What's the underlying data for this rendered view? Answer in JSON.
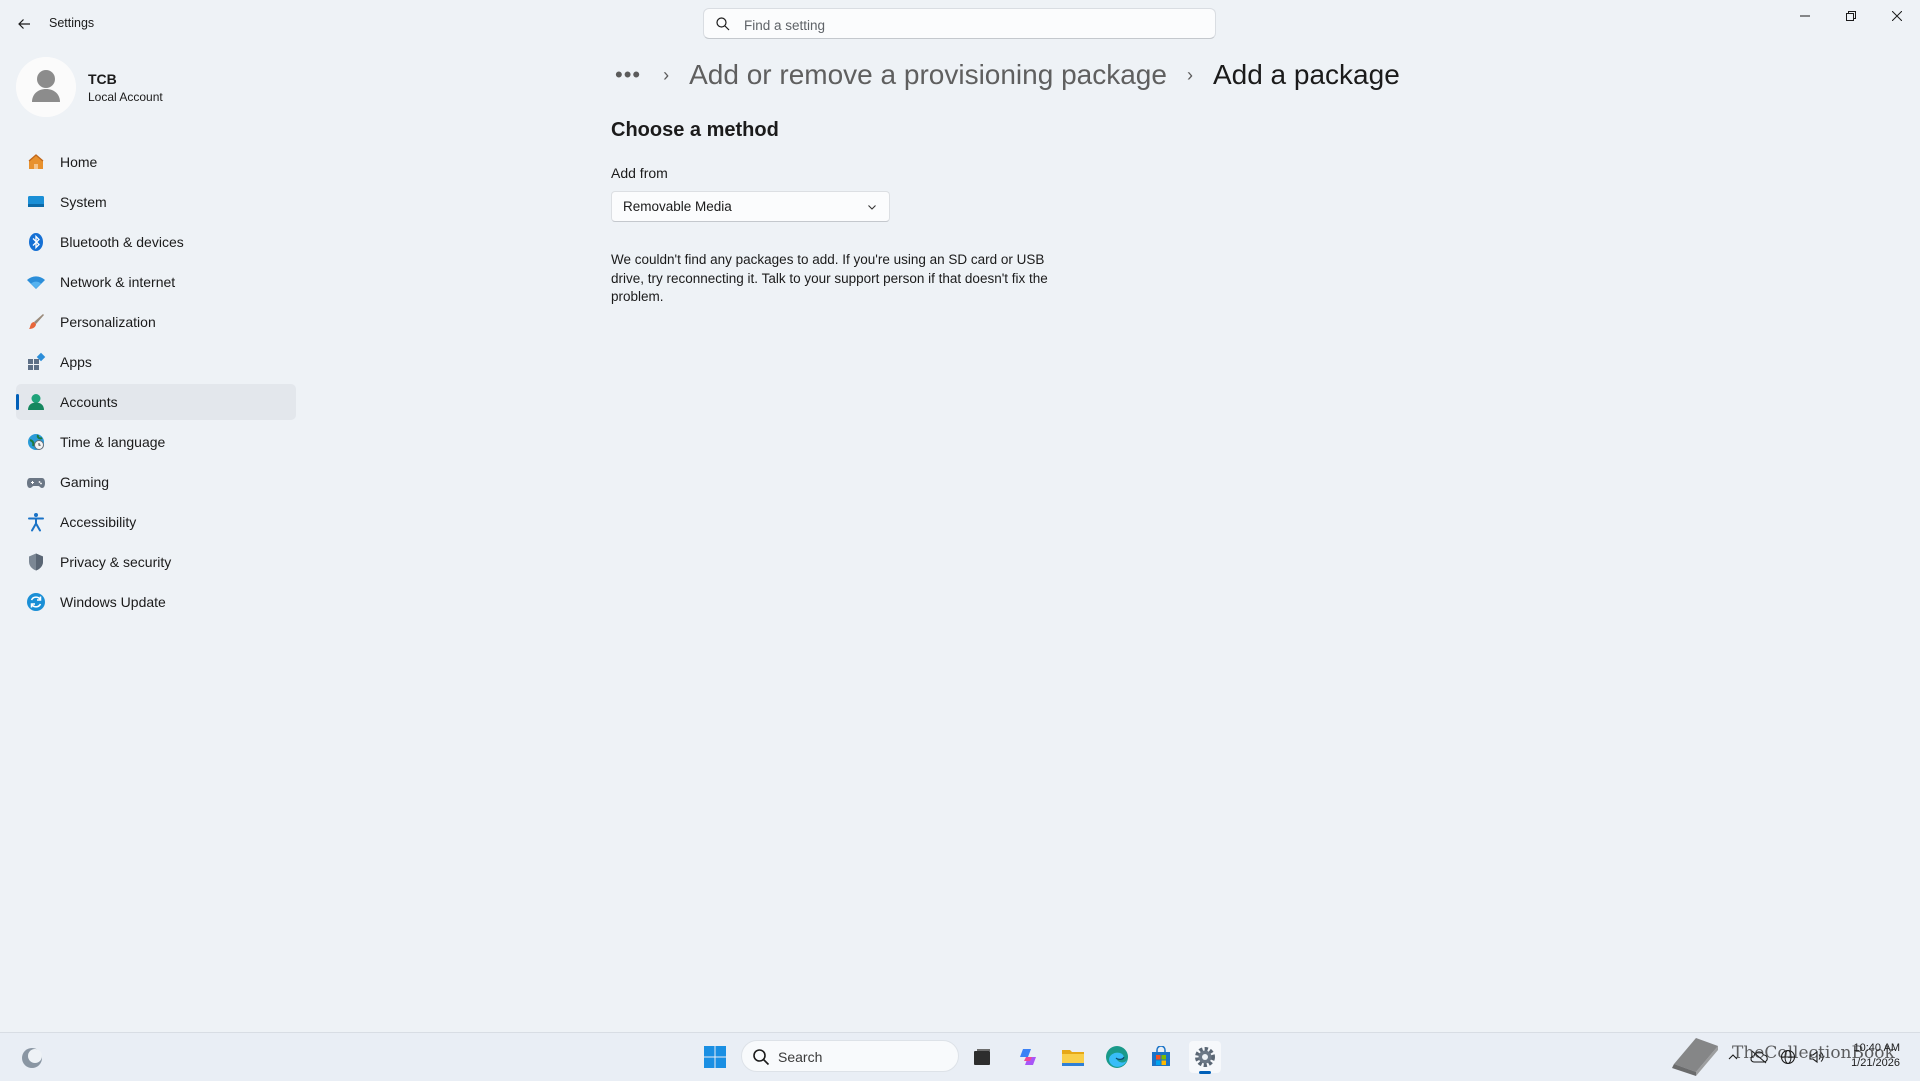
{
  "window": {
    "title": "Settings",
    "search_placeholder": "Find a setting"
  },
  "account": {
    "name": "TCB",
    "type": "Local Account"
  },
  "sidebar": {
    "items": [
      {
        "label": "Home",
        "icon": "home-icon"
      },
      {
        "label": "System",
        "icon": "system-icon"
      },
      {
        "label": "Bluetooth & devices",
        "icon": "bluetooth-icon"
      },
      {
        "label": "Network & internet",
        "icon": "wifi-icon"
      },
      {
        "label": "Personalization",
        "icon": "brush-icon"
      },
      {
        "label": "Apps",
        "icon": "apps-icon"
      },
      {
        "label": "Accounts",
        "icon": "accounts-icon",
        "selected": true
      },
      {
        "label": "Time & language",
        "icon": "globe-clock-icon"
      },
      {
        "label": "Gaming",
        "icon": "gamepad-icon"
      },
      {
        "label": "Accessibility",
        "icon": "accessibility-icon"
      },
      {
        "label": "Privacy & security",
        "icon": "shield-icon"
      },
      {
        "label": "Windows Update",
        "icon": "update-icon"
      }
    ]
  },
  "breadcrumb": {
    "more": "•••",
    "parent": "Add or remove a provisioning package",
    "current": "Add a package"
  },
  "content": {
    "section_title": "Choose a method",
    "add_from_label": "Add from",
    "add_from_value": "Removable Media",
    "message": "We couldn't find any packages to add. If you're using an SD card or USB drive, try reconnecting it. Talk to your support person if that doesn't fix the problem."
  },
  "taskbar": {
    "search_label": "Search",
    "time": "10:40 AM",
    "date": "1/21/2026",
    "watermark": "TheCollectionBook"
  },
  "colors": {
    "accent": "#005fb8",
    "background": "#eef2f6"
  }
}
